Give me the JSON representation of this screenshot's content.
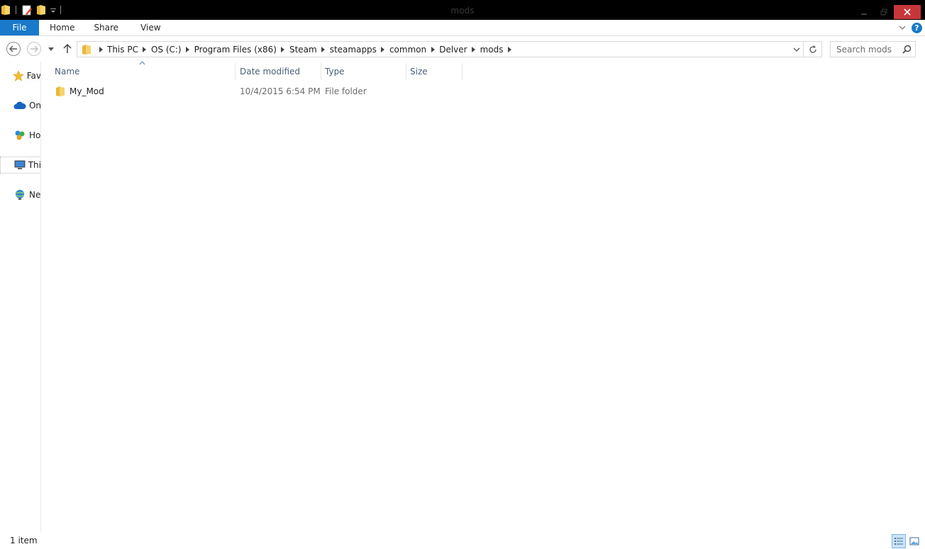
{
  "window": {
    "title": "mods"
  },
  "ribbon": {
    "tabs": [
      {
        "label": "File"
      },
      {
        "label": "Home"
      },
      {
        "label": "Share"
      },
      {
        "label": "View"
      }
    ]
  },
  "address": {
    "crumbs": [
      "This PC",
      "OS (C:)",
      "Program Files (x86)",
      "Steam",
      "steamapps",
      "common",
      "Delver",
      "mods"
    ]
  },
  "search": {
    "placeholder": "Search mods"
  },
  "navpane": {
    "items": [
      {
        "label": "Fav",
        "icon": "star-icon"
      },
      {
        "label": "On",
        "icon": "cloud-icon"
      },
      {
        "label": "Ho",
        "icon": "homegroup-icon"
      },
      {
        "label": "Thi",
        "icon": "computer-icon"
      },
      {
        "label": "Ne",
        "icon": "network-icon"
      }
    ]
  },
  "columns": {
    "name": "Name",
    "date": "Date modified",
    "type": "Type",
    "size": "Size"
  },
  "files": [
    {
      "name": "My_Mod",
      "date": "10/4/2015 6:54 PM",
      "type": "File folder",
      "size": "",
      "icon": "folder-icon"
    }
  ],
  "status": {
    "count": "1 item"
  },
  "colors": {
    "accent": "#1979ca",
    "close": "#c7373a",
    "header_text": "#4c607a"
  }
}
